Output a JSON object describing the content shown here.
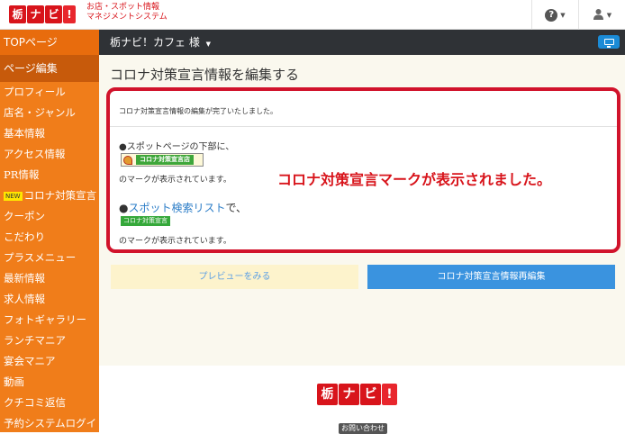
{
  "brand": {
    "logo_chars": [
      "栃",
      "ナ",
      "ビ",
      "!"
    ],
    "tagline_line1": "お店・スポット情報",
    "tagline_line2": "マネジメントシステム",
    "color": "#d8141b"
  },
  "topnav": {
    "help_icon": "question-circle-icon",
    "help_symbol": "?",
    "user_icon": "user-icon",
    "user_symbol": "👤"
  },
  "header": {
    "shop_name": "栃ナビ！カフェ 様"
  },
  "sidebar": {
    "top_label": "TOPページ",
    "active_label": "ページ編集",
    "items": [
      {
        "label": "プロフィール"
      },
      {
        "label": "店名・ジャンル"
      },
      {
        "label": "基本情報"
      },
      {
        "label": "アクセス情報"
      },
      {
        "label": "PR情報"
      },
      {
        "label": "コロナ対策宣言",
        "badge": "NEW"
      },
      {
        "label": "クーポン"
      },
      {
        "label": "こだわり"
      },
      {
        "label": "プラスメニュー"
      },
      {
        "label": "最新情報"
      },
      {
        "label": "求人情報"
      },
      {
        "label": "フォトギャラリー"
      },
      {
        "label": "ランチマニア"
      },
      {
        "label": "宴会マニア"
      },
      {
        "label": "動画"
      },
      {
        "label": "クチコミ返信"
      },
      {
        "label": "予約システムログイ"
      }
    ],
    "color": "#f07d1a"
  },
  "main": {
    "title": "コロナ対策宣言情報を編集する",
    "alert": {
      "message": "コロナ対策宣言情報の編集が完了いたしました。",
      "bullet1": "●スポットページの下部に、",
      "mark_label": "コロナ対策宣言店",
      "note1": "のマークが表示されています。",
      "bullet2_prefix": "●",
      "bullet2_link": "スポット検索リスト",
      "bullet2_suffix": "で、",
      "tag_label": "コロナ対策宣言",
      "note2": "のマークが表示されています。",
      "border_color": "#d1132b"
    },
    "annotation": "コロナ対策宣言マークが表示されました。",
    "buttons": {
      "preview": "プレビューをみる",
      "reedit": "コロナ対策宣言情報再編集"
    }
  },
  "footer": {
    "logo_chars": [
      "栃",
      "ナ",
      "ビ",
      "!"
    ],
    "contact": "お問い合わせ"
  }
}
